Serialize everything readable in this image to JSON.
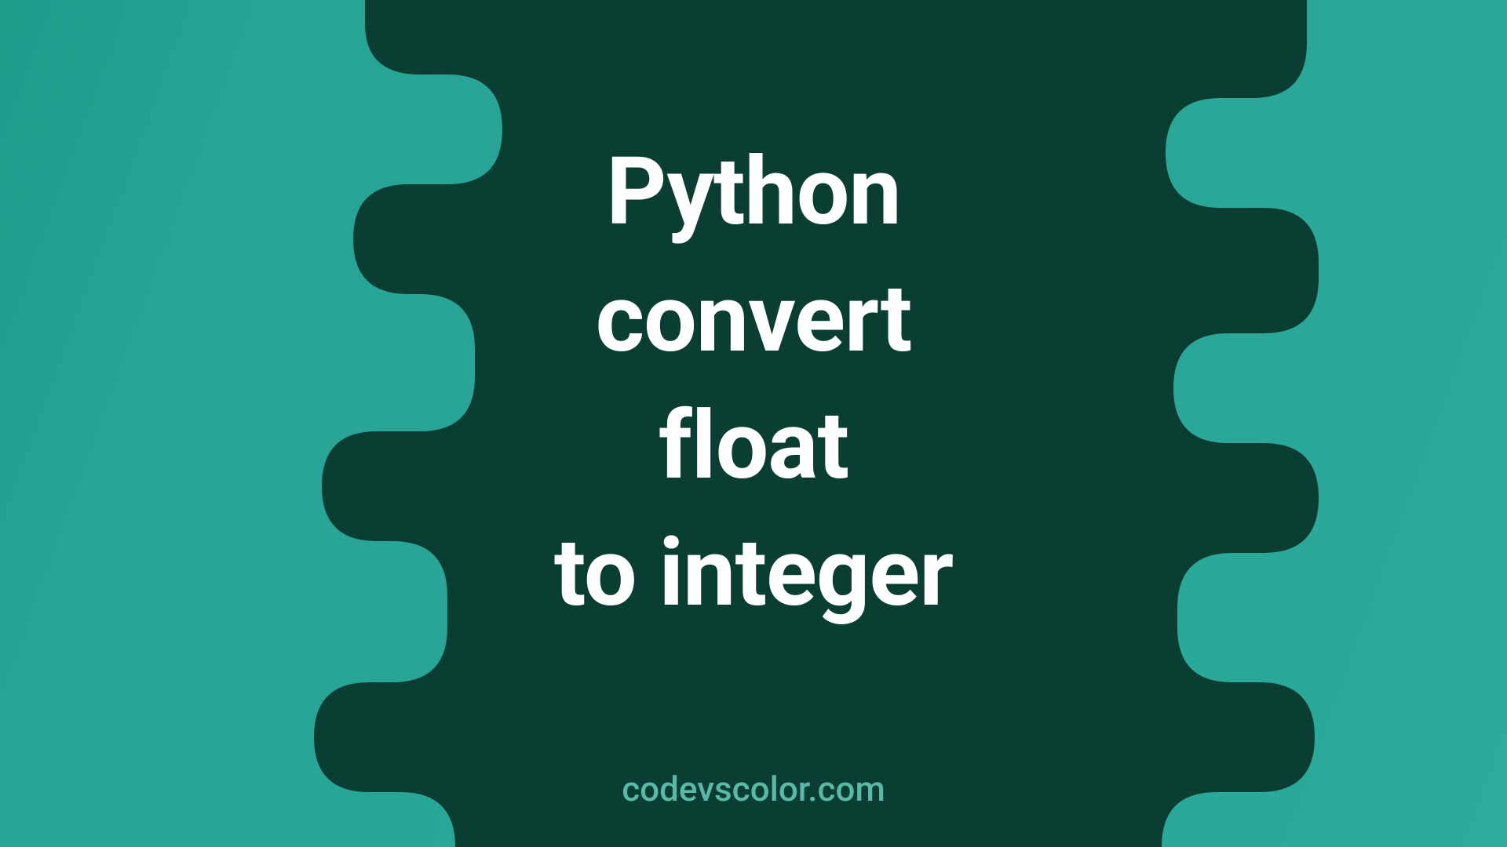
{
  "title_line1": "Python",
  "title_line2": "convert",
  "title_line3": "float",
  "title_line4": "to integer",
  "watermark": "codevscolor.com",
  "colors": {
    "bg_light_start": "#1f9b8c",
    "bg_light_end": "#2dac9d",
    "blob_dark": "#0b3e33",
    "text_primary": "#ffffff",
    "text_watermark": "#5ab8a9"
  }
}
